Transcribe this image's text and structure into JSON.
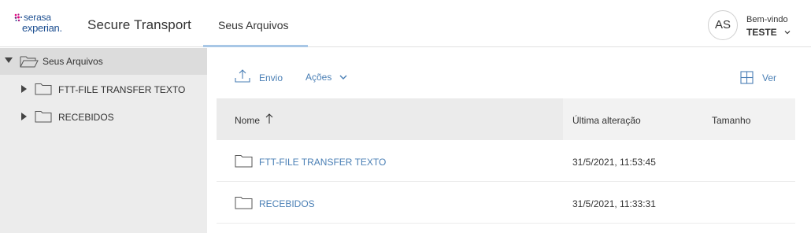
{
  "header": {
    "logo_line1": "serasa",
    "logo_line2": "experian.",
    "app_title": "Secure Transport",
    "nav_tab": "Seus Arquivos",
    "avatar_initials": "AS",
    "welcome": "Bem-vindo",
    "username": "TESTE"
  },
  "sidebar": {
    "root_label": "Seus Arquivos",
    "items": [
      {
        "label": "FTT-FILE TRANSFER TEXTO"
      },
      {
        "label": "RECEBIDOS"
      }
    ]
  },
  "toolbar": {
    "upload_label": "Envio",
    "actions_label": "Ações",
    "view_label": "Ver"
  },
  "table": {
    "columns": [
      "Nome",
      "Última alteração",
      "Tamanho"
    ],
    "sort_icon": "arrow-up-icon",
    "rows": [
      {
        "name": "FTT-FILE TRANSFER TEXTO",
        "modified": "31/5/2021, 11:53:45",
        "size": ""
      },
      {
        "name": "RECEBIDOS",
        "modified": "31/5/2021, 11:33:31",
        "size": ""
      }
    ]
  },
  "colors": {
    "brand_blue": "#1d4f91",
    "link_blue": "#4a7fb5",
    "tab_underline": "#a8c7e6",
    "sidebar_bg": "#ececec",
    "sidebar_selected_bg": "#dcdcdc",
    "table_header_bg": "#f2f2f2"
  }
}
